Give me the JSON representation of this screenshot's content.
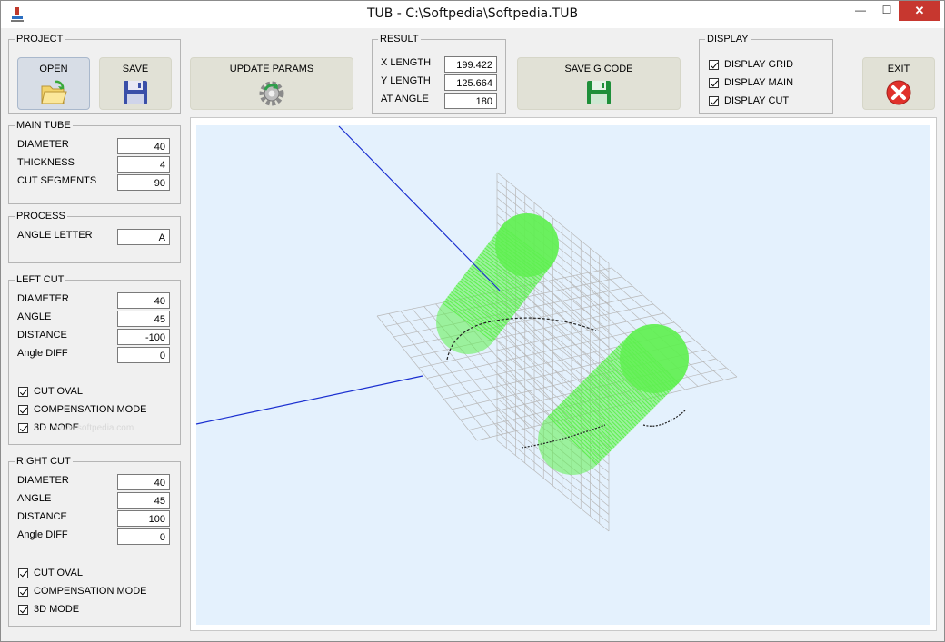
{
  "window": {
    "title": "TUB - C:\\Softpedia\\Softpedia.TUB",
    "minimize_glyph": "—",
    "maximize_glyph": "☐",
    "close_glyph": "✕"
  },
  "project": {
    "legend": "PROJECT",
    "open_label": "OPEN",
    "save_label": "SAVE"
  },
  "update_params_label": "UPDATE PARAMS",
  "result": {
    "legend": "RESULT",
    "x_length_label": "X LENGTH",
    "x_length_value": "199.422",
    "y_length_label": "Y LENGTH",
    "y_length_value": "125.664",
    "at_angle_label": "AT ANGLE",
    "at_angle_value": "180"
  },
  "save_gcode_label": "SAVE G CODE",
  "display": {
    "legend": "DISPLAY",
    "grid_label": "DISPLAY GRID",
    "main_label": "DISPLAY MAIN",
    "cut_label": "DISPLAY CUT",
    "grid_checked": true,
    "main_checked": true,
    "cut_checked": true
  },
  "exit_label": "EXIT",
  "main_tube": {
    "legend": "MAIN TUBE",
    "diameter_label": "DIAMETER",
    "diameter_value": "40",
    "thickness_label": "THICKNESS",
    "thickness_value": "4",
    "cut_segments_label": "CUT SEGMENTS",
    "cut_segments_value": "90"
  },
  "process": {
    "legend": "PROCESS",
    "angle_letter_label": "ANGLE LETTER",
    "angle_letter_value": "A"
  },
  "left_cut": {
    "legend": "LEFT CUT",
    "diameter_label": "DIAMETER",
    "diameter_value": "40",
    "angle_label": "ANGLE",
    "angle_value": "45",
    "distance_label": "DISTANCE",
    "distance_value": "-100",
    "angle_diff_label": "Angle DIFF",
    "angle_diff_value": "0",
    "cut_oval_label": "CUT OVAL",
    "compensation_label": "COMPENSATION MODE",
    "mode3d_label": "3D MODE"
  },
  "right_cut": {
    "legend": "RIGHT CUT",
    "diameter_label": "DIAMETER",
    "diameter_value": "40",
    "angle_label": "ANGLE",
    "angle_value": "45",
    "distance_label": "DISTANCE",
    "distance_value": "100",
    "angle_diff_label": "Angle DIFF",
    "angle_diff_value": "0",
    "cut_oval_label": "CUT OVAL",
    "compensation_label": "COMPENSATION MODE",
    "mode3d_label": "3D MODE"
  },
  "watermark": "www.softpedia.com",
  "colors": {
    "viewport_bg": "#e4f1fd",
    "grid": "#b8b8b8",
    "tube": "#5ef04f",
    "axis": "#1a2fd0"
  }
}
